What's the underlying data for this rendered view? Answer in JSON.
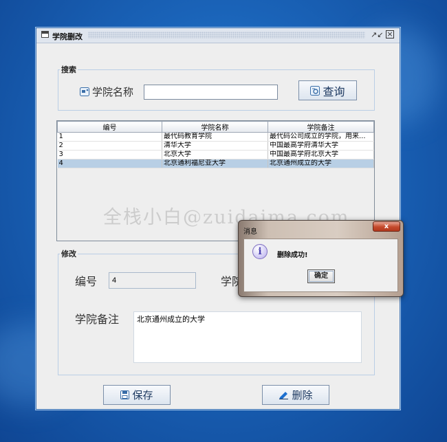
{
  "window": {
    "title": "学院删改"
  },
  "search": {
    "legend": "搜索",
    "label": "学院名称",
    "value": "",
    "button_label": "查询"
  },
  "table": {
    "columns": [
      "编号",
      "学院名称",
      "学院备注"
    ],
    "rows": [
      {
        "id": "1",
        "name": "最代码教育学院",
        "note": "最代码公司成立的学院，用来..."
      },
      {
        "id": "2",
        "name": "清华大学",
        "note": "中国最高学府清华大学"
      },
      {
        "id": "3",
        "name": "北京大学",
        "note": "中国最高学府北京大学"
      },
      {
        "id": "4",
        "name": "北京通利福尼亚大学",
        "note": "北京通州成立的大学"
      }
    ],
    "selected_row": 3
  },
  "watermark": "全栈小白@zuidaima.com",
  "edit": {
    "legend": "修改",
    "id_label": "编号",
    "id_value": "4",
    "name_label": "学院",
    "note_label": "学院备注",
    "note_value": "北京通州成立的大学"
  },
  "buttons": {
    "save_label": "保存",
    "delete_label": "删除"
  },
  "dialog": {
    "title": "消息",
    "close": "x",
    "message": "删除成功!",
    "ok_label": "确定",
    "icon": "info-icon"
  },
  "colors": {
    "desktop": "#1a63b8",
    "selection": "#b8cfe5",
    "group_border": "#b9cde5",
    "button_text": "#1c3860"
  }
}
